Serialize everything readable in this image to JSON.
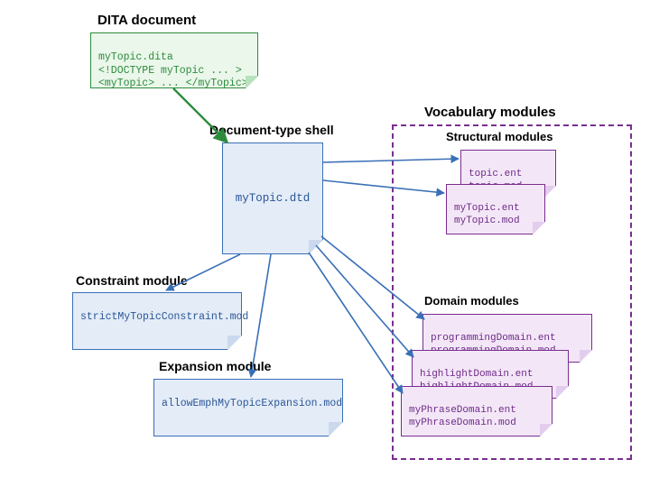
{
  "headings": {
    "dita_document": "DITA document",
    "shell": "Document-type shell",
    "vocabulary": "Vocabulary modules",
    "structural": "Structural modules",
    "constraint": "Constraint module",
    "expansion": "Expansion module",
    "domain": "Domain modules"
  },
  "dita_doc": {
    "filename": "myTopic.dita",
    "line2": "<!DOCTYPE myTopic ... >",
    "line3": "<myTopic> ... </myTopic>"
  },
  "shell": {
    "filename": "myTopic.dtd"
  },
  "structural": {
    "topic_ent": "topic.ent",
    "topic_mod": "topic.mod",
    "mytopic_ent": "myTopic.ent",
    "mytopic_mod": "myTopic.mod"
  },
  "constraint": {
    "filename": "strictMyTopicConstraint.mod"
  },
  "expansion": {
    "filename": "allowEmphMyTopicExpansion.mod"
  },
  "domain": {
    "prog_ent": "programmingDomain.ent",
    "prog_mod": "programmingDomain.mod",
    "hl_ent": "highlightDomain.ent",
    "hl_mod": "highlightDomain.mod",
    "phrase_ent": "myPhraseDomain.ent",
    "phrase_mod": "myPhraseDomain.mod"
  },
  "colors": {
    "green": "#2e8b3d",
    "blue": "#3a6fb7",
    "purple": "#7a2d8f"
  }
}
